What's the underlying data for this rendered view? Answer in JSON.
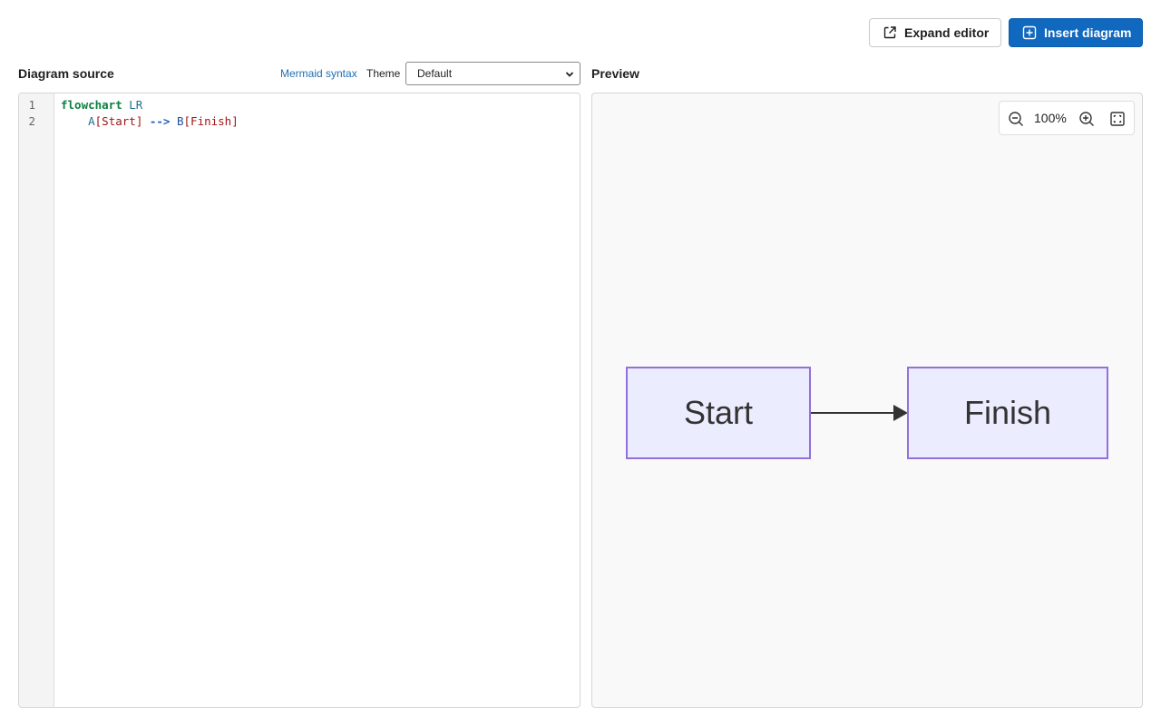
{
  "header": {
    "expand_label": "Expand editor",
    "insert_label": "Insert diagram"
  },
  "source": {
    "title": "Diagram source",
    "syntax_link": "Mermaid syntax",
    "theme_label": "Theme",
    "theme_value": "Default",
    "lines": [
      {
        "number": "1",
        "tokens": {
          "kw": "flowchart",
          "dir": "LR"
        }
      },
      {
        "number": "2",
        "tokens": {
          "a_id": "A",
          "a_open": "[",
          "a_text": "Start",
          "a_close": "]",
          "arrow": "-->",
          "b_id": "B",
          "b_open": "[",
          "b_text": "Finish",
          "b_close": "]"
        }
      }
    ]
  },
  "preview": {
    "title": "Preview",
    "zoom": "100%",
    "nodes": [
      {
        "label": "Start"
      },
      {
        "label": "Finish"
      }
    ]
  },
  "colors": {
    "primary": "#1068bf",
    "node_fill": "#ececff",
    "node_border": "#9370db"
  }
}
